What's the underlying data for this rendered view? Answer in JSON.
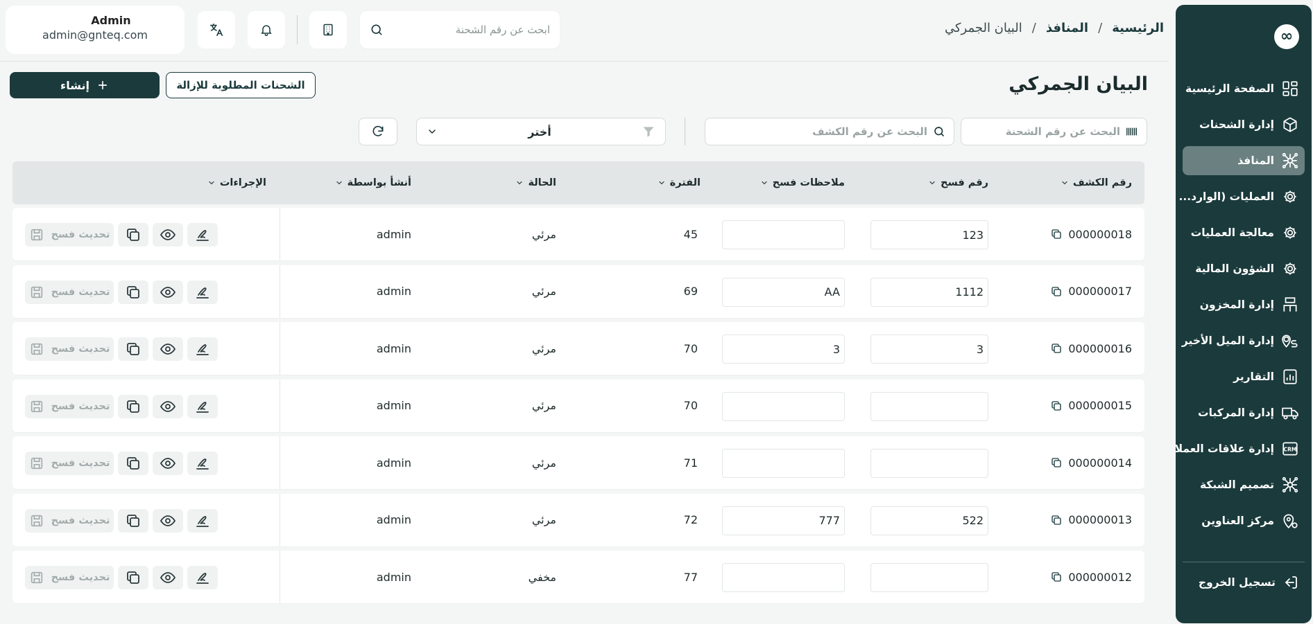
{
  "sidebar": {
    "logo_glyph": "∞",
    "items": [
      {
        "label": "الصفحة الرئيسية",
        "icon": "dashboard-icon",
        "active": false
      },
      {
        "label": "إدارة الشحنات",
        "icon": "package-icon",
        "active": false
      },
      {
        "label": "المنافذ",
        "icon": "network-icon",
        "active": true
      },
      {
        "label": "العمليات (الوارد...",
        "icon": "gear-icon",
        "active": false
      },
      {
        "label": "معالجة العمليات",
        "icon": "gear-icon",
        "active": false
      },
      {
        "label": "الشؤون المالية",
        "icon": "gear-icon",
        "active": false
      },
      {
        "label": "إدارة المخزون",
        "icon": "warehouse-icon",
        "active": false
      },
      {
        "label": "إدارة الميل الأخير",
        "icon": "route-icon",
        "active": false
      },
      {
        "label": "التقارير",
        "icon": "report-icon",
        "active": false
      },
      {
        "label": "إدارة المركبات",
        "icon": "truck-icon",
        "active": false
      },
      {
        "label": "إدارة علاقات العملاء",
        "icon": "crm-icon",
        "active": false
      },
      {
        "label": "تصميم الشبكة",
        "icon": "network-icon",
        "active": false
      },
      {
        "label": "مركز العناوين",
        "icon": "location-icon",
        "active": false
      }
    ],
    "logout_label": "تسجيل الخروج"
  },
  "breadcrumb": {
    "home": "الرئيسية",
    "section": "المنافذ",
    "current": "البيان الجمركي",
    "separator": "/"
  },
  "header": {
    "search_placeholder": "ابحث عن رقم الشحنة",
    "user_name": "Admin",
    "user_email": "admin@gnteq.com"
  },
  "page": {
    "title": "البيان الجمركي",
    "create_label": "إنشاء",
    "removal_label": "الشحنات المطلوبة للإزالة"
  },
  "filters": {
    "shipment_placeholder": "البحث عن رقم الشحنة",
    "manifest_placeholder": "البحث عن رقم الكشف",
    "select_value": "أختر"
  },
  "table": {
    "columns": {
      "manifest_no": "رقم الكشف",
      "fasah_no": "رقم فسح",
      "fasah_notes": "ملاحظات فسح",
      "period": "الفترة",
      "status": "الحالة",
      "created_by": "أنشأ بواسطة",
      "actions": "الإجراءات"
    },
    "update_label": "تحديث فسح",
    "rows": [
      {
        "manifest_no": "000000018",
        "fasah_no": "123",
        "fasah_notes": "",
        "period": "45",
        "status": "مرئي",
        "created_by": "admin"
      },
      {
        "manifest_no": "000000017",
        "fasah_no": "1112",
        "fasah_notes": "AA",
        "period": "69",
        "status": "مرئي",
        "created_by": "admin"
      },
      {
        "manifest_no": "000000016",
        "fasah_no": "3",
        "fasah_notes": "3",
        "period": "70",
        "status": "مرئي",
        "created_by": "admin"
      },
      {
        "manifest_no": "000000015",
        "fasah_no": "",
        "fasah_notes": "",
        "period": "70",
        "status": "مرئي",
        "created_by": "admin"
      },
      {
        "manifest_no": "000000014",
        "fasah_no": "",
        "fasah_notes": "",
        "period": "71",
        "status": "مرئي",
        "created_by": "admin"
      },
      {
        "manifest_no": "000000013",
        "fasah_no": "522",
        "fasah_notes": "777",
        "period": "72",
        "status": "مرئي",
        "created_by": "admin"
      },
      {
        "manifest_no": "000000012",
        "fasah_no": "",
        "fasah_notes": "",
        "period": "77",
        "status": "مخفي",
        "created_by": "admin"
      }
    ]
  }
}
